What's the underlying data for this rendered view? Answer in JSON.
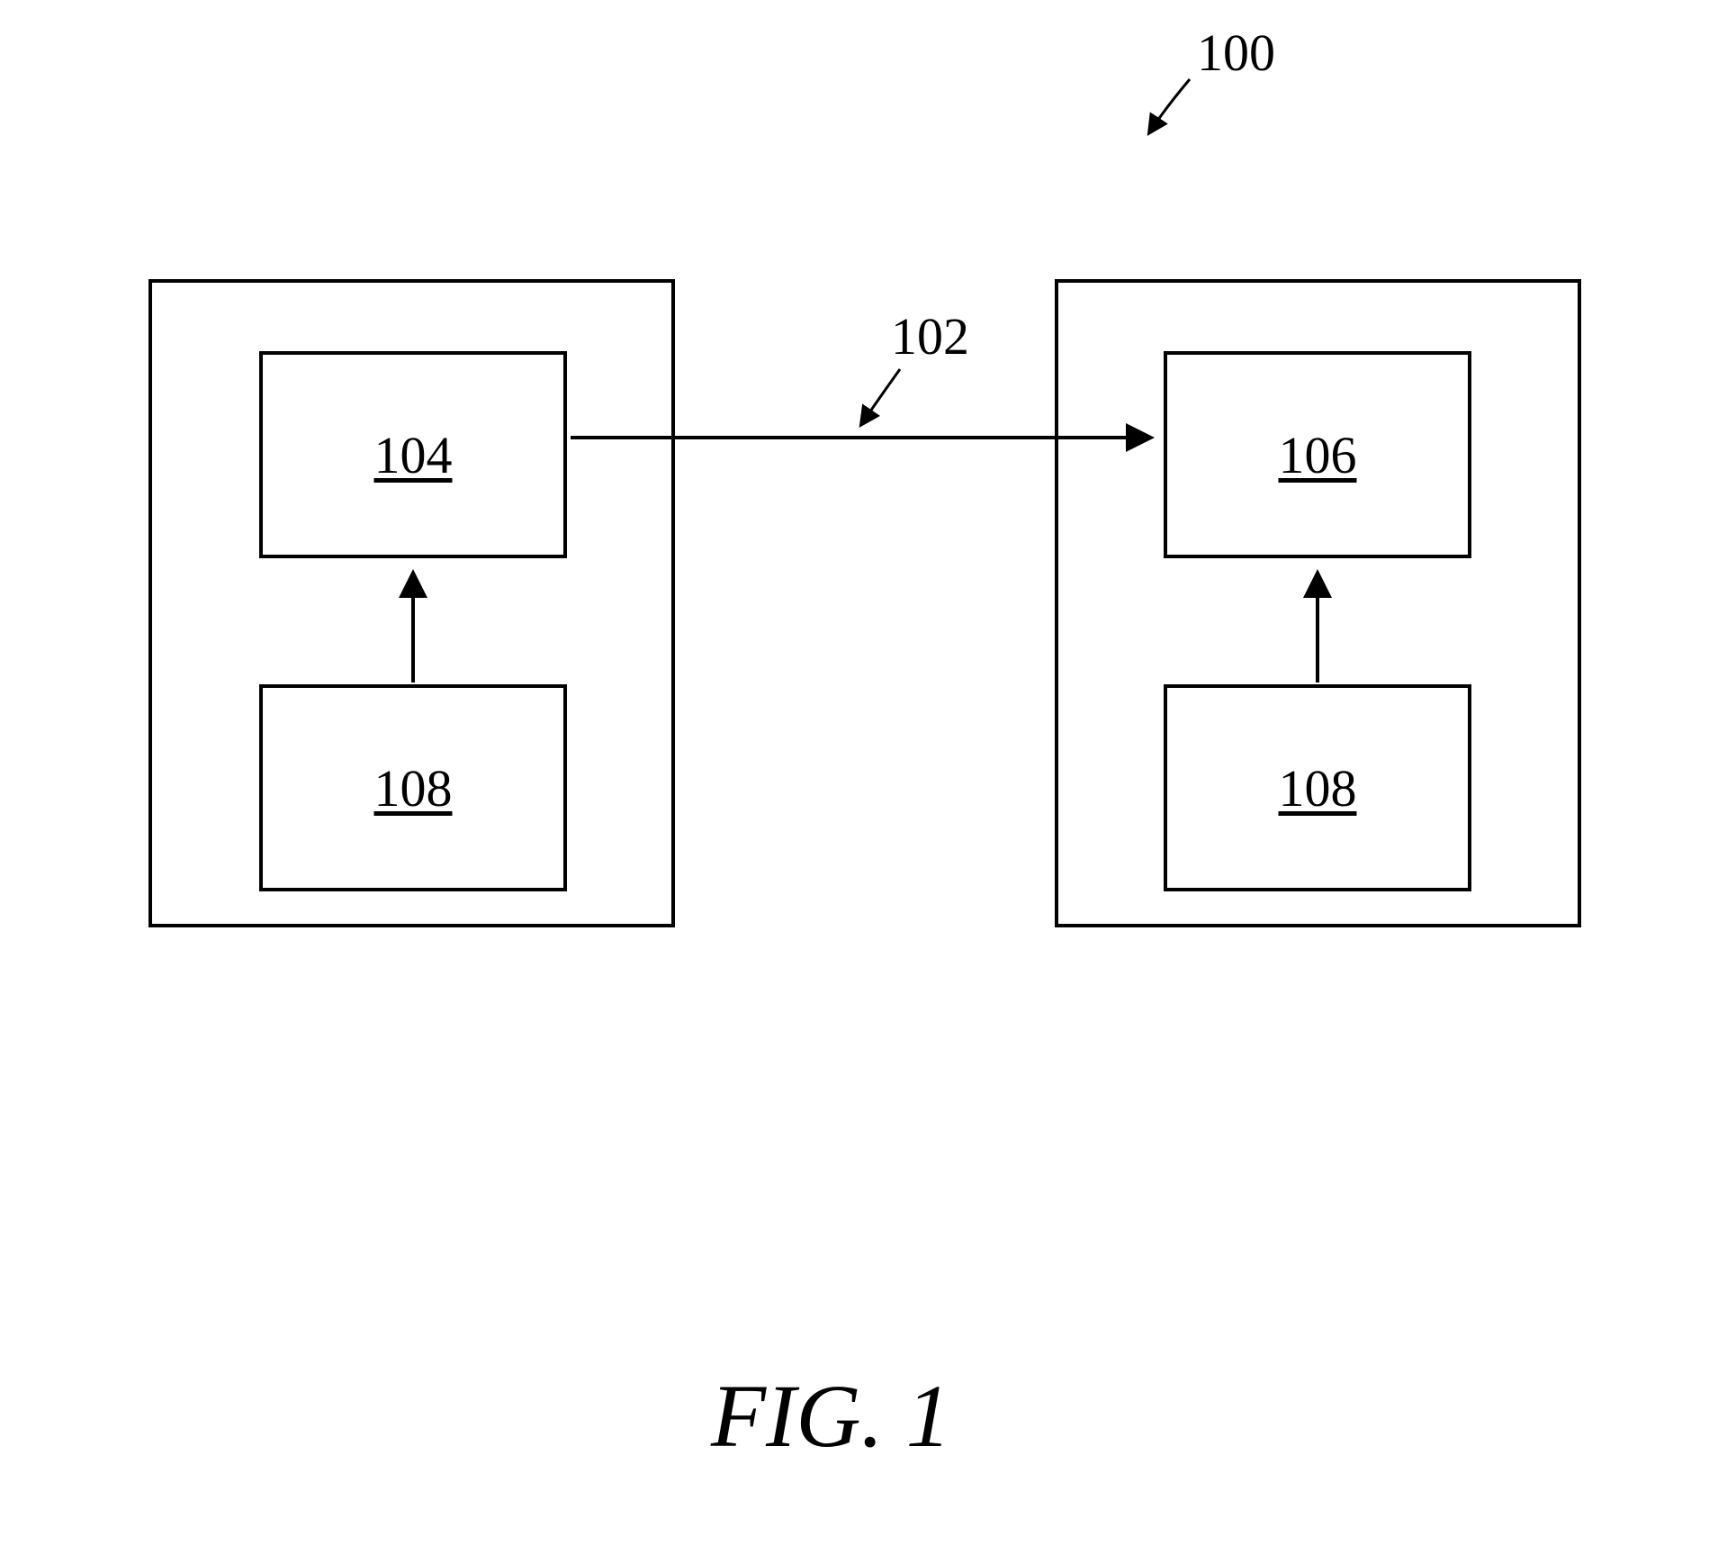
{
  "figure": {
    "caption": "FIG. 1",
    "system_ref": "100",
    "connection_ref": "102",
    "left_device": {
      "top_block_ref": "104",
      "bottom_block_ref": "108"
    },
    "right_device": {
      "top_block_ref": "106",
      "bottom_block_ref": "108"
    }
  }
}
